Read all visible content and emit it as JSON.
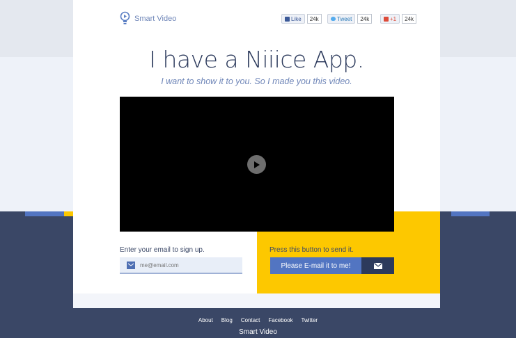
{
  "brand": {
    "name": "Smart Video"
  },
  "social": [
    {
      "label": "Like",
      "count": "24k",
      "icon": "thumbs-up-icon"
    },
    {
      "label": "Tweet",
      "count": "24k",
      "icon": "twitter-bird-icon"
    },
    {
      "label": "+1",
      "count": "24k",
      "icon": "google-plus-icon"
    }
  ],
  "hero": {
    "title": "I have a Niiice App.",
    "subtitle": "I want to show it to you. So I made you this video."
  },
  "video": {
    "play_icon": "play-icon"
  },
  "signup": {
    "label": "Enter your email to sign up.",
    "email_placeholder": "me@email.com",
    "press_label": "Press this button to send it.",
    "button_label": "Please E-mail it to me!"
  },
  "footer": {
    "links": [
      "About",
      "Blog",
      "Contact",
      "Facebook",
      "Twitter"
    ],
    "brand": "Smart Video"
  },
  "colors": {
    "navy": "#3a4766",
    "accent_blue": "#5275c2",
    "yellow": "#fdc800",
    "text_blue": "#6f86b8"
  }
}
